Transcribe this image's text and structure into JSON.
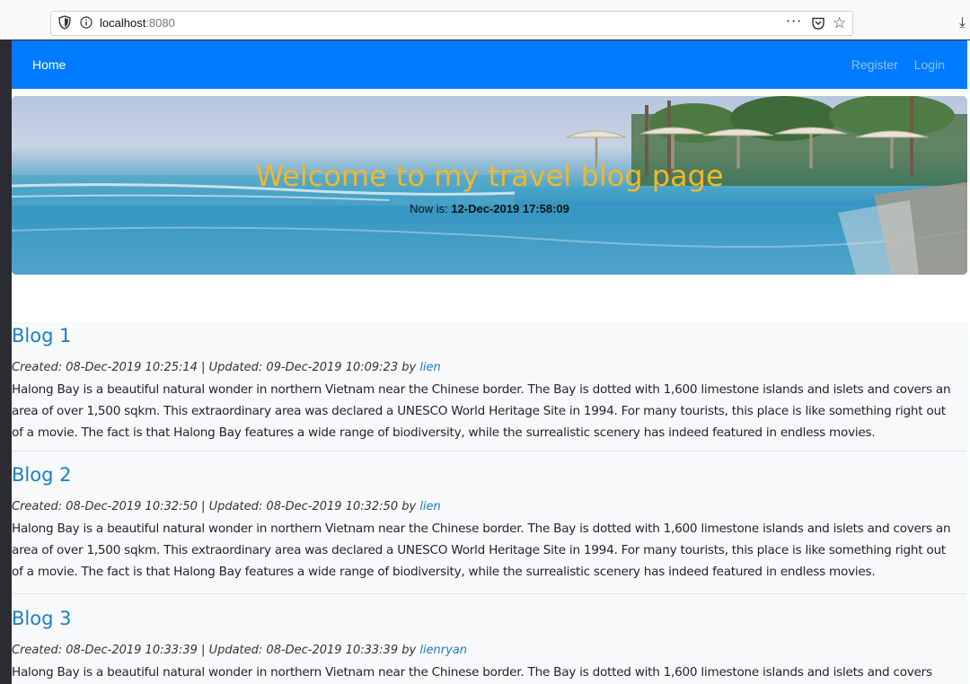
{
  "browser": {
    "url_host": "localhost",
    "url_port": ":8080",
    "more_label": "···"
  },
  "navbar": {
    "home": "Home",
    "register": "Register",
    "login": "Login"
  },
  "hero": {
    "title": "Welcome to my travel blog page",
    "now_label": "Now is: ",
    "now_value": "12-Dec-2019 17:58:09"
  },
  "blogs": [
    {
      "title": "Blog 1",
      "meta": "Created: 08-Dec-2019 10:25:14 | Updated: 09-Dec-2019 10:09:23 by ",
      "author": "lien",
      "body": "Halong Bay is a beautiful natural wonder in northern Vietnam near the Chinese border. The Bay is dotted with 1,600 limestone islands and islets and covers an area of over 1,500 sqkm. This extraordinary area was declared a UNESCO World Heritage Site in 1994. For many tourists, this place is like something right out of a movie. The fact is that Halong Bay features a wide range of biodiversity, while the surrealistic scenery has indeed featured in endless movies."
    },
    {
      "title": "Blog 2",
      "meta": "Created: 08-Dec-2019 10:32:50 | Updated: 08-Dec-2019 10:32:50 by ",
      "author": "lien",
      "body": "Halong Bay is a beautiful natural wonder in northern Vietnam near the Chinese border. The Bay is dotted with 1,600 limestone islands and islets and covers an area of over 1,500 sqkm. This extraordinary area was declared a UNESCO World Heritage Site in 1994. For many tourists, this place is like something right out of a movie. The fact is that Halong Bay features a wide range of biodiversity, while the surrealistic scenery has indeed featured in endless movies."
    },
    {
      "title": "Blog 3",
      "meta": "Created: 08-Dec-2019 10:33:39 | Updated: 08-Dec-2019 10:33:39 by ",
      "author": "lienryan",
      "body": "Halong Bay is a beautiful natural wonder in northern Vietnam near the Chinese border. The Bay is dotted with 1,600 limestone islands and islets and covers"
    }
  ],
  "colors": {
    "navbar": "#007bff",
    "hero_title": "#f0b82a",
    "link": "#1a7fc4"
  }
}
